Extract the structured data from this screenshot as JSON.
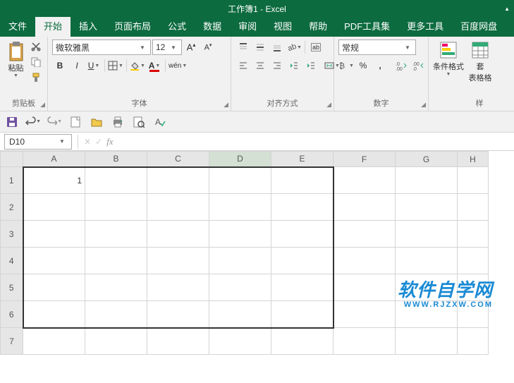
{
  "title": "工作簿1 - Excel",
  "tabs": [
    "文件",
    "开始",
    "插入",
    "页面布局",
    "公式",
    "数据",
    "审阅",
    "视图",
    "帮助",
    "PDF工具集",
    "更多工具",
    "百度网盘"
  ],
  "activeTab": 1,
  "ribbon": {
    "clipboard": {
      "label": "剪贴板",
      "paste": "粘贴"
    },
    "font": {
      "label": "字体",
      "name": "微软雅黑",
      "size": "12",
      "bold": "B",
      "italic": "I",
      "underline": "U",
      "ruby": "wén"
    },
    "align": {
      "label": "对齐方式",
      "wrap": "ab"
    },
    "number": {
      "label": "数字",
      "format": "常规"
    },
    "styles": {
      "cond": "条件格式",
      "tbl": "套\n表格格"
    }
  },
  "namebox": "D10",
  "columns": [
    "A",
    "B",
    "C",
    "D",
    "E",
    "F",
    "G",
    "H"
  ],
  "rows": [
    "1",
    "2",
    "3",
    "4",
    "5",
    "6",
    "7"
  ],
  "cells": {
    "A1": "1"
  },
  "watermark": {
    "line1": "软件自学网",
    "line2": "WWW.RJZXW.COM"
  },
  "chart_data": null
}
